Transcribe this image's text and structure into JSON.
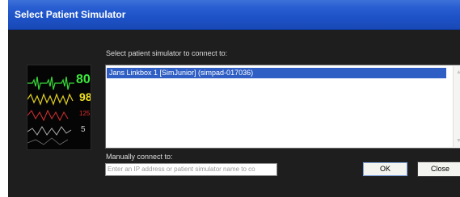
{
  "window": {
    "title": "Select Patient Simulator"
  },
  "dialog": {
    "prompt": "Select patient simulator to connect to:",
    "simulators": [
      "Jans Linkbox 1 [SimJunior] (simpad-017036)"
    ],
    "manual_label": "Manually connect to:",
    "manual_placeholder": "Enter an IP address or patient simulator name to co",
    "ok_label": "OK",
    "close_label": "Close"
  },
  "monitor_image": {
    "readings": [
      "80",
      "98",
      "125",
      "5"
    ]
  }
}
